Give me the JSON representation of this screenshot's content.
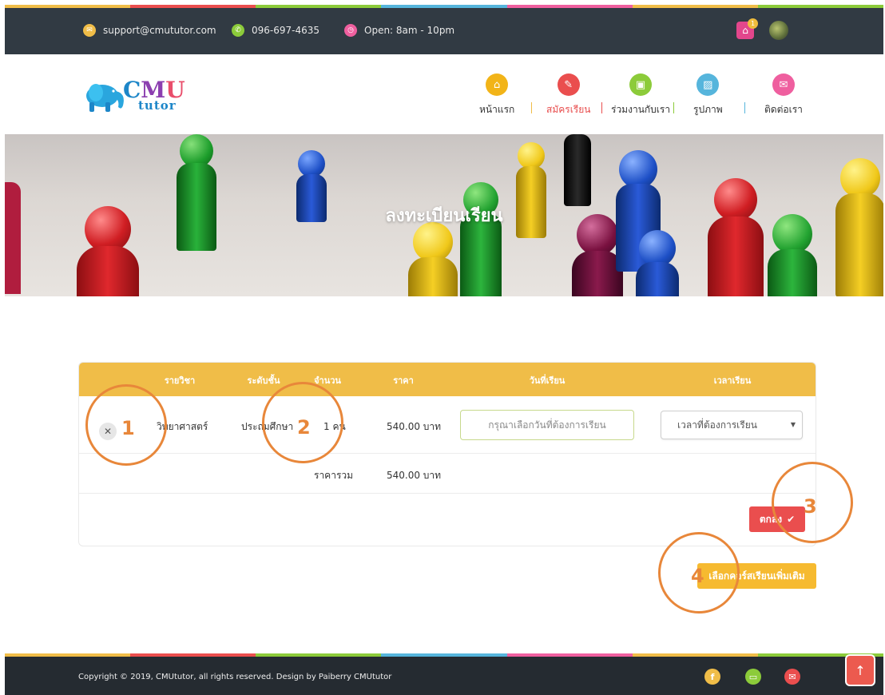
{
  "topbar": {
    "email": "support@cmututor.com",
    "phone": "096-697-4635",
    "hours": "Open: 8am - 10pm",
    "cart_count": "1",
    "icons": {
      "email": "mail-icon",
      "phone": "phone-icon",
      "hours": "clock-icon",
      "cart": "cart-icon"
    }
  },
  "logo": {
    "line1": "CMU",
    "line2": "tutor"
  },
  "nav": {
    "items": [
      {
        "label": "หน้าแรก",
        "icon": "home-icon",
        "color": "#f2b418"
      },
      {
        "label": "สมัครเรียน",
        "icon": "pencil-icon",
        "color": "#ea4e4e"
      },
      {
        "label": "ร่วมงานกับเรา",
        "icon": "briefcase-icon",
        "color": "#8ccb3a"
      },
      {
        "label": "รูปภาพ",
        "icon": "image-icon",
        "color": "#56b5dc"
      },
      {
        "label": "ติดต่อเรา",
        "icon": "mail-icon",
        "color": "#ef5f9f"
      }
    ]
  },
  "banner": {
    "title": "ลงทะเบียนเรียน"
  },
  "table": {
    "headers": [
      "รายวิชา",
      "ระดับชั้น",
      "จำนวน",
      "ราคา",
      "วันที่เรียน",
      "เวลาเรียน"
    ],
    "row": {
      "subject": "วิทยาศาสตร์",
      "level": "ประถมศึกษา",
      "quantity": "1 คน",
      "price": "540.00 บาท",
      "date_placeholder": "กรุณาเลือกวันที่ต้องการเรียน",
      "time_value": "เวลาที่ต้องการเรียน"
    },
    "total_label": "ราคารวม",
    "total_value": "540.00 บาท",
    "ok_label": "ตกลง"
  },
  "more_courses_label": "เลือกคอร์สเรียนเพิ่มเติม",
  "annotations": [
    "1",
    "2",
    "3",
    "4"
  ],
  "footer": {
    "copyright": "Copyright © 2019, CMUtutor, all rights reserved. Design by Paiberry CMUtutor",
    "social": [
      "facebook-icon",
      "line-icon",
      "mail-icon"
    ]
  },
  "colors": {
    "topbar_bg": "#313a43",
    "header_yellow": "#f0bd48",
    "accent_red": "#ea4e4e",
    "button_orange": "#f6ba30",
    "annotation": "#e8873a"
  }
}
